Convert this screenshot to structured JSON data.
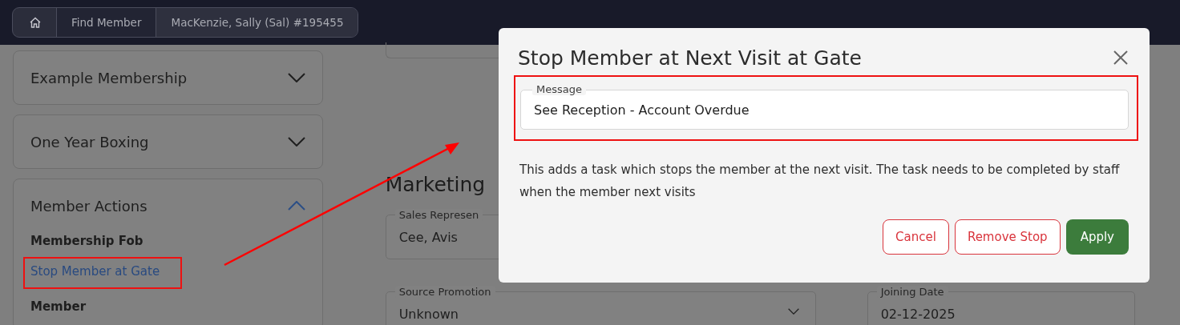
{
  "breadcrumb": [
    {
      "kind": "home"
    },
    {
      "kind": "link",
      "label": "Find Member"
    },
    {
      "kind": "current",
      "label": "MacKenzie, Sally (Sal) #195455"
    }
  ],
  "sidebar": {
    "panels": [
      {
        "title": "Example Membership",
        "expanded": false
      },
      {
        "title": "One Year Boxing",
        "expanded": false
      },
      {
        "title": "Member Actions",
        "expanded": true,
        "items": [
          {
            "kind": "heading",
            "label": "Membership Fob"
          },
          {
            "kind": "link",
            "label": "Stop Member at Gate"
          },
          {
            "kind": "heading",
            "label": "Member"
          }
        ]
      }
    ]
  },
  "section": {
    "title": "Marketing",
    "fields": [
      {
        "kind": "text",
        "label": "Sales Represen",
        "value": "Cee, Avis"
      },
      {
        "kind": "dropdown",
        "label": "Source Promotion",
        "value": "Unknown"
      },
      {
        "kind": "text",
        "label": "Joining Date",
        "value": "02-12-2025"
      }
    ]
  },
  "dialog": {
    "title": "Stop Member at Next Visit at Gate",
    "message_field": {
      "label": "Message",
      "value": "See Reception - Account Overdue"
    },
    "description": "This adds a task which stops the member at the next visit. The task needs to be completed by staff when the member next visits",
    "buttons": [
      {
        "kind": "outline",
        "label": "Cancel"
      },
      {
        "kind": "outline",
        "label": "Remove Stop"
      },
      {
        "kind": "primary",
        "label": "Apply"
      }
    ]
  }
}
